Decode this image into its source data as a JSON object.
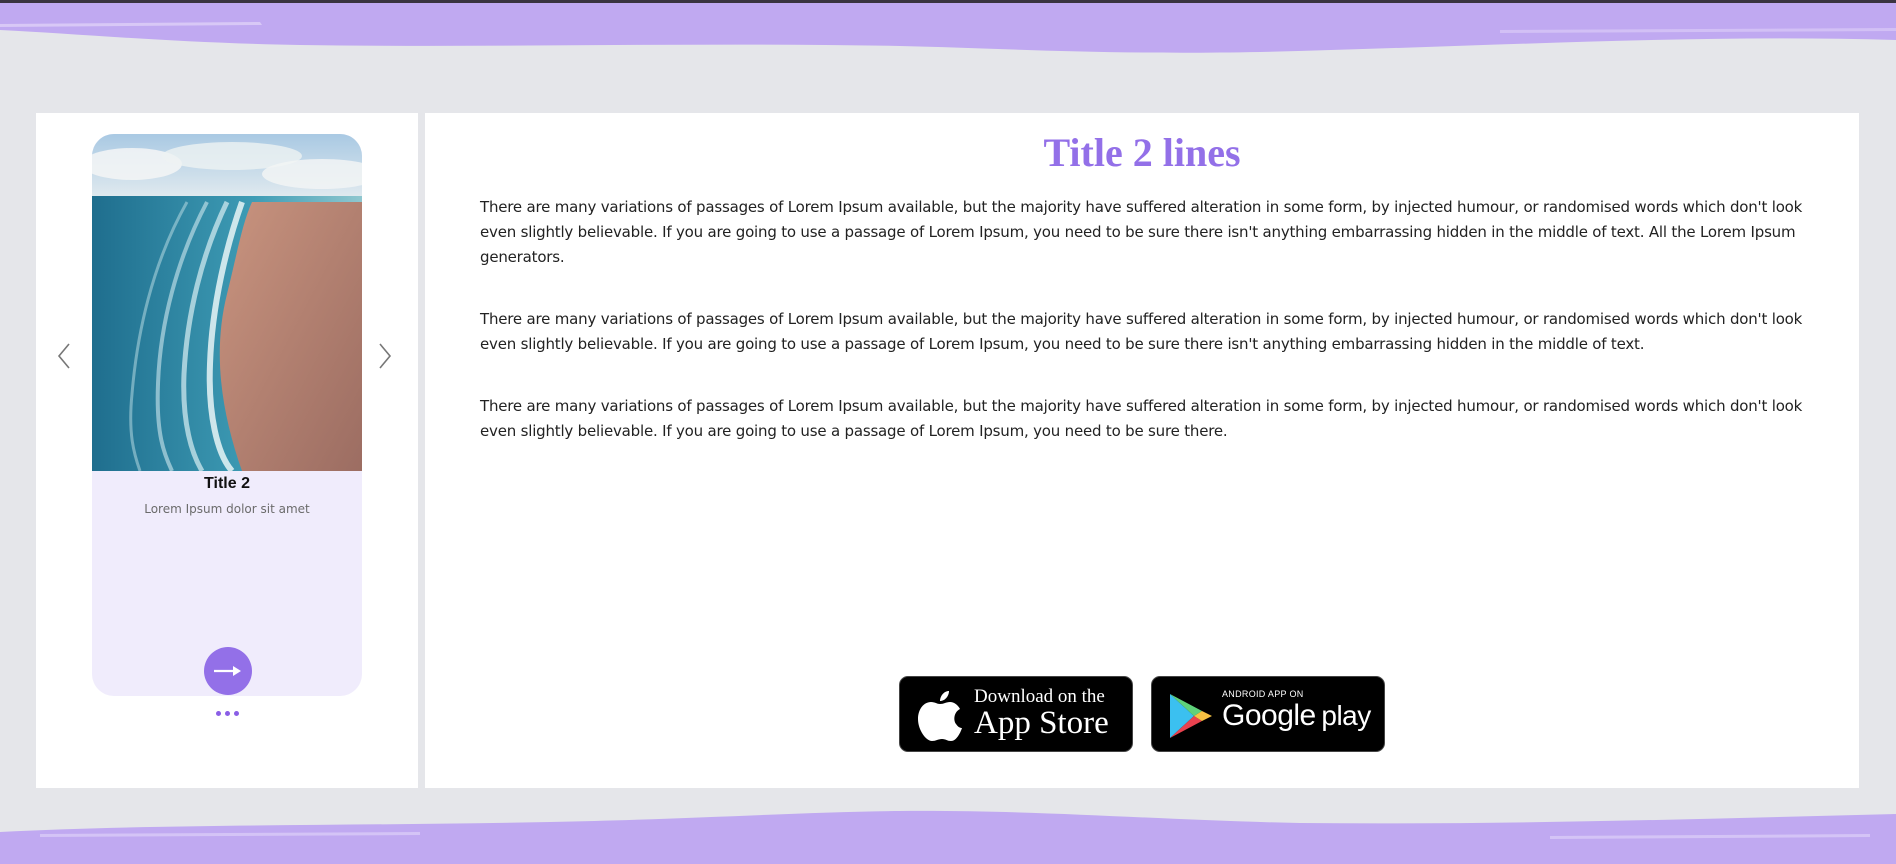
{
  "colors": {
    "accent": "#9370e8",
    "brush": "#c0a9f1",
    "background": "#e5e6ea",
    "card_bg": "#f0ecfc"
  },
  "slider": {
    "prev_icon": "chevron-left-icon",
    "next_icon": "chevron-right-icon",
    "card": {
      "image_desc_icon": "beach-photo",
      "title": "Title 2",
      "subtitle": "Lorem Ipsum dolor sit amet",
      "action_icon": "arrow-right-icon"
    },
    "dot_count": 3
  },
  "content": {
    "title": "Title 2 lines",
    "paragraphs": [
      "There are many variations of passages of Lorem Ipsum available, but the majority have suffered alteration in some form, by injected humour, or randomised words which don't look even slightly believable. If you are going to use a passage of Lorem Ipsum, you need to be sure there isn't anything embarrassing hidden in the middle of text. All the Lorem Ipsum generators.",
      "There are many variations of passages of Lorem Ipsum available, but the majority have suffered alteration in some form, by injected humour, or randomised words which don't look even slightly believable. If you are going to use a passage of Lorem Ipsum, you need to be sure there isn't anything embarrassing hidden in the middle of text.",
      "There are many variations of passages of Lorem Ipsum available, but the majority have suffered alteration in some form, by injected humour, or randomised words which don't look even slightly believable. If you are going to use a passage of Lorem Ipsum, you need to be sure there."
    ]
  },
  "badges": {
    "apple": {
      "line1": "Download on the",
      "line2": "App Store",
      "icon": "apple-icon"
    },
    "google": {
      "line1": "ANDROID APP ON",
      "line2": "Google",
      "line3": "play",
      "icon": "google-play-icon"
    }
  }
}
